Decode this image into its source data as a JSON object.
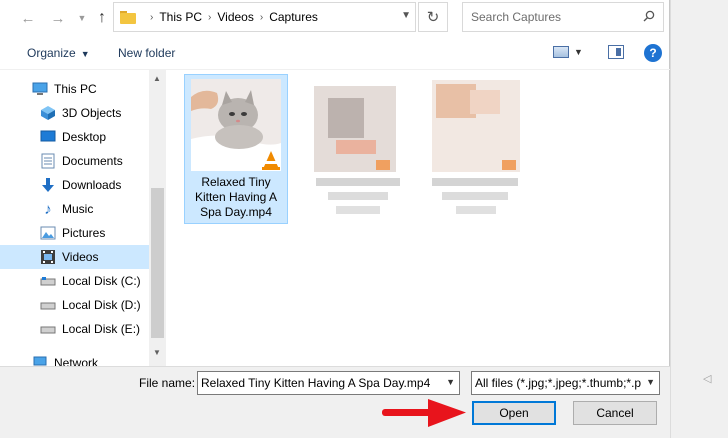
{
  "address": {
    "crumbs": [
      "This PC",
      "Videos",
      "Captures"
    ],
    "search_placeholder": "Search Captures"
  },
  "toolbar": {
    "organize_label": "Organize",
    "new_folder_label": "New folder",
    "help_label": "?"
  },
  "nav": {
    "items": [
      {
        "label": "This PC",
        "icon": "computer-icon"
      },
      {
        "label": "3D Objects",
        "icon": "3d-objects-icon"
      },
      {
        "label": "Desktop",
        "icon": "desktop-icon"
      },
      {
        "label": "Documents",
        "icon": "documents-icon"
      },
      {
        "label": "Downloads",
        "icon": "downloads-icon"
      },
      {
        "label": "Music",
        "icon": "music-icon"
      },
      {
        "label": "Pictures",
        "icon": "pictures-icon"
      },
      {
        "label": "Videos",
        "icon": "videos-icon",
        "selected": true
      },
      {
        "label": "Local Disk (C:)",
        "icon": "drive-icon"
      },
      {
        "label": "Local Disk (D:)",
        "icon": "drive-icon"
      },
      {
        "label": "Local Disk (E:)",
        "icon": "drive-icon"
      },
      {
        "label": "Network",
        "icon": "network-icon"
      }
    ]
  },
  "files": [
    {
      "name": "Relaxed Tiny Kitten Having A Spa Day.mp4",
      "selected": true,
      "blurred": false
    },
    {
      "name": "",
      "selected": false,
      "blurred": true
    },
    {
      "name": "",
      "selected": false,
      "blurred": true
    }
  ],
  "bottom": {
    "file_name_label": "File name:",
    "file_name_value": "Relaxed Tiny Kitten Having A Spa Day.mp4",
    "file_type_value": "All files (*.jpg;*.jpeg;*.thumb;*.p",
    "open_label": "Open",
    "cancel_label": "Cancel"
  },
  "colors": {
    "selection": "#cce8ff",
    "accent": "#0078d7",
    "annotation_arrow": "#e8141c"
  }
}
